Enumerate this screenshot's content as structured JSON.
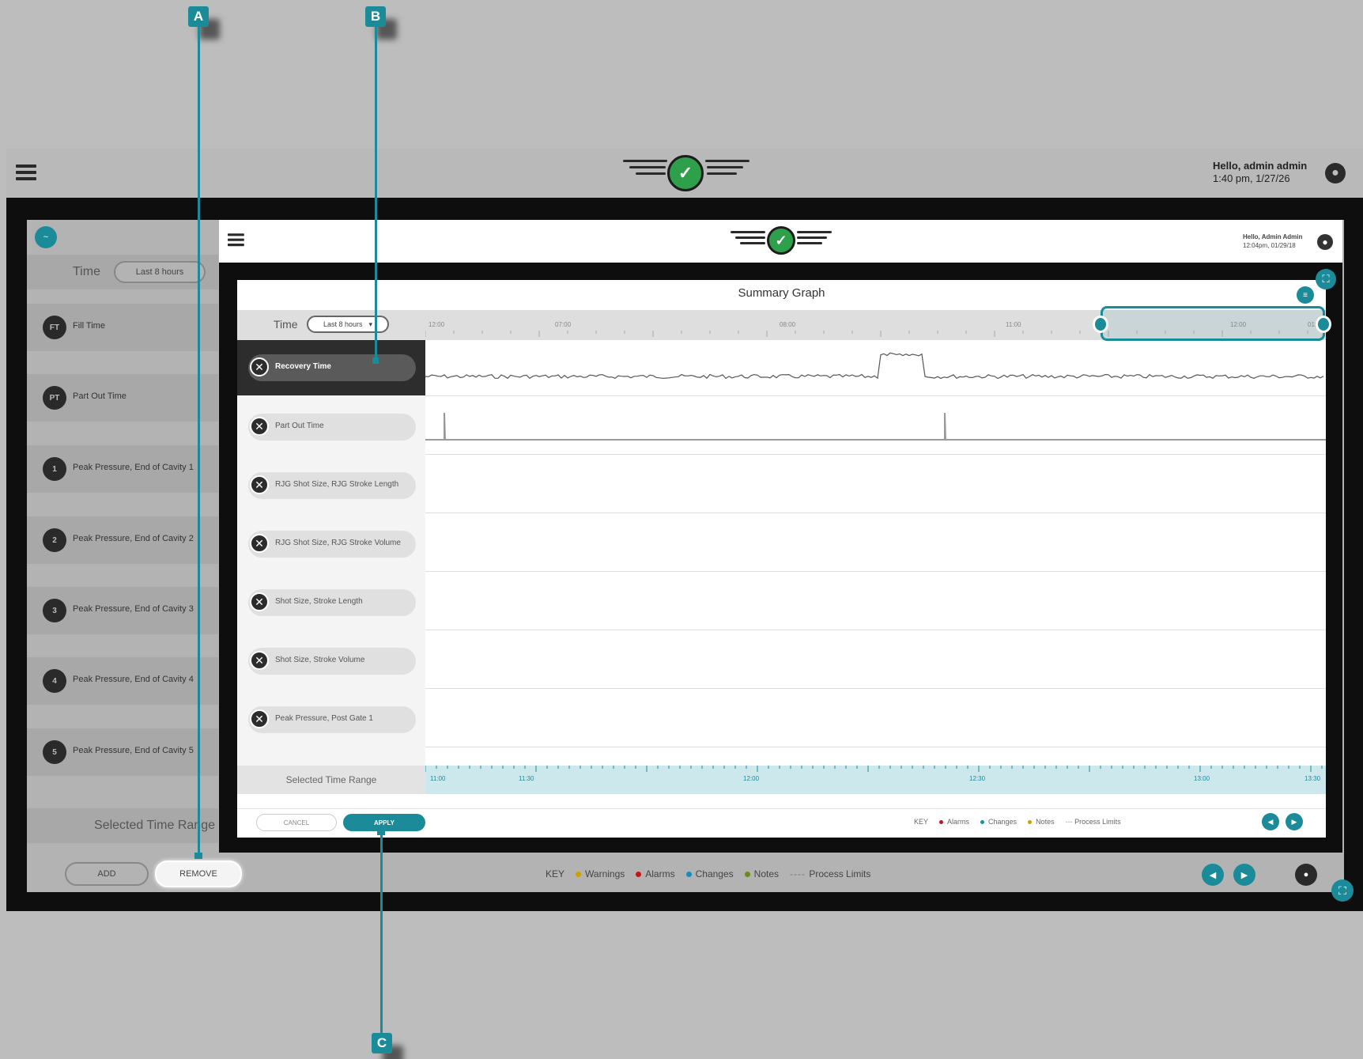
{
  "background_app": {
    "greeting": "Hello, admin admin",
    "datetime": "1:40 pm, 1/27/26",
    "time_label": "Time",
    "time_select": "Last 8 hours",
    "items": [
      {
        "badge": "FT",
        "label": "Fill Time"
      },
      {
        "badge": "PT",
        "label": "Part Out Time"
      },
      {
        "badge": "1",
        "label": "Peak Pressure, End of Cavity 1"
      },
      {
        "badge": "2",
        "label": "Peak Pressure, End of Cavity 2"
      },
      {
        "badge": "3",
        "label": "Peak Pressure, End of Cavity 3"
      },
      {
        "badge": "4",
        "label": "Peak Pressure, End of Cavity 4"
      },
      {
        "badge": "5",
        "label": "Peak Pressure, End of Cavity 5"
      }
    ],
    "selected_time_range": "Selected Time Range",
    "add_button": "ADD",
    "remove_button": "REMOVE",
    "key": {
      "label": "KEY",
      "entries": [
        {
          "label": "Warnings",
          "color": "#c9a100"
        },
        {
          "label": "Alarms",
          "color": "#c01818"
        },
        {
          "label": "Changes",
          "color": "#1b8bb8"
        },
        {
          "label": "Notes",
          "color": "#6a8a1a"
        },
        {
          "label": "Process Limits",
          "color": "#777777"
        }
      ]
    }
  },
  "foreground_app": {
    "greeting": "Hello, Admin Admin",
    "datetime": "12:04pm, 01/29/18",
    "graph_title": "Summary Graph",
    "time_label": "Time",
    "time_select": "Last 8 hours",
    "time_ticks": [
      "12:00",
      "07:00",
      "08:00",
      "11:00",
      "12:00",
      "01:"
    ],
    "series": [
      {
        "label": "Recovery Time",
        "selected": true
      },
      {
        "label": "Part Out Time",
        "selected": false
      },
      {
        "label": "RJG Shot Size, RJG Stroke Length",
        "selected": false
      },
      {
        "label": "RJG Shot Size, RJG Stroke Volume",
        "selected": false
      },
      {
        "label": "Shot Size, Stroke Length",
        "selected": false
      },
      {
        "label": "Shot Size, Stroke Volume",
        "selected": false
      },
      {
        "label": "Peak Pressure, Post Gate 1",
        "selected": false
      }
    ],
    "selected_time_range": "Selected Time Range",
    "range_ticks": [
      "11:00",
      "11:30",
      "12:00",
      "12:30",
      "13:00",
      "13:30"
    ],
    "cancel_button": "CANCEL",
    "apply_button": "APPLY",
    "key": {
      "label": "KEY",
      "entries": [
        {
          "label": "Alarms",
          "color": "#c01818"
        },
        {
          "label": "Changes",
          "color": "#1b8bb8"
        },
        {
          "label": "Notes",
          "color": "#c9a100"
        },
        {
          "label": "Process Limits",
          "color": "#999999"
        }
      ]
    }
  },
  "callouts": {
    "a": "A",
    "b": "B",
    "c": "C"
  },
  "colors": {
    "accent": "#1b8b99",
    "ok_green": "#2e9f4a"
  }
}
